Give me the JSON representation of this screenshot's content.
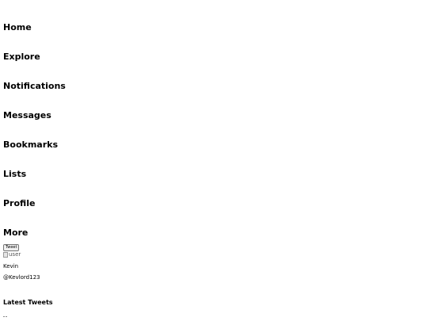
{
  "nav": {
    "items": [
      {
        "label": "Home"
      },
      {
        "label": "Explore"
      },
      {
        "label": "Notifications"
      },
      {
        "label": "Messages"
      },
      {
        "label": "Bookmarks"
      },
      {
        "label": "Lists"
      },
      {
        "label": "Profile"
      },
      {
        "label": "More"
      }
    ]
  },
  "tweet_button": {
    "label": "Tweet"
  },
  "user": {
    "avatar_alt": "user",
    "name": "Kevin",
    "handle": "@Kevlord123"
  },
  "main": {
    "section_title": "Latest Tweets"
  }
}
